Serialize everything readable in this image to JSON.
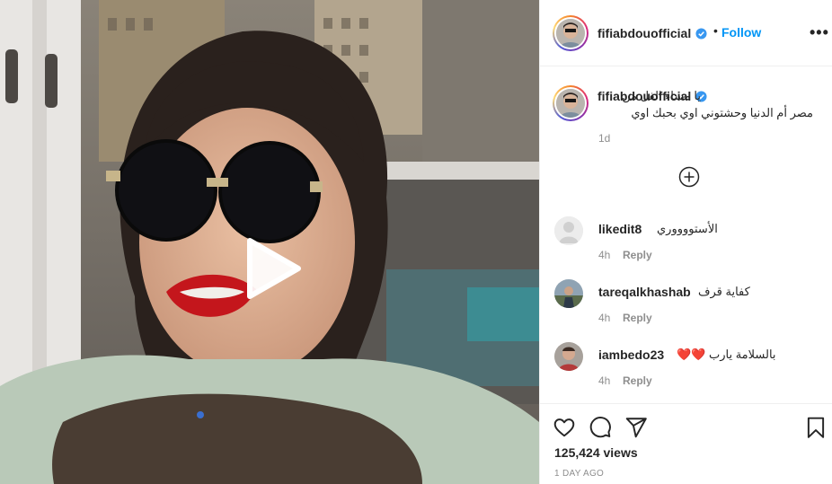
{
  "post": {
    "username": "fifiabdouofficial",
    "follow_label": "Follow",
    "dot": "•",
    "more": "•••",
    "caption": "يا مساء الفل من مصر أم الدنيا وحشتوني اوي بحبك اوي",
    "caption_time": "1d",
    "views": "125,424 views",
    "posted_ago": "1 DAY AGO"
  },
  "comments": [
    {
      "username": "likedit8",
      "text": "الأستووووري",
      "time": "4h",
      "reply": "Reply"
    },
    {
      "username": "tareqalkhashab",
      "text": "كفاية قرف",
      "time": "4h",
      "reply": "Reply"
    },
    {
      "username": "iambedo23",
      "text": "بالسلامة يارب ❤️❤️",
      "time": "4h",
      "reply": "Reply"
    }
  ],
  "colors": {
    "accent": "#0095f6",
    "text": "#262626",
    "muted": "#8e8e8e",
    "verified": "#3897f0",
    "lips": "#c4161c"
  },
  "icons": [
    "play-icon",
    "verified-icon",
    "more-icon",
    "plus-circle-icon",
    "heart-icon",
    "comment-icon",
    "share-icon",
    "bookmark-icon"
  ]
}
